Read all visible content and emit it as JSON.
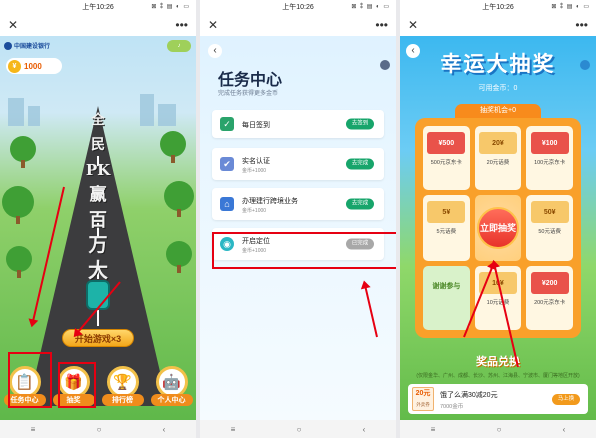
{
  "status_time": "上午10:26",
  "status_icons": "⊠ ⁑ ▤ ◐ ▭",
  "top_close": "✕",
  "top_more": "•••",
  "nav_buttons": [
    "≡",
    "○",
    "‹"
  ],
  "panel1": {
    "bank_name": "中国建设银行",
    "coin_icon": "¥",
    "coins": "1000",
    "slogan_chars": [
      "全",
      "民",
      "PK",
      "赢",
      "百",
      "万",
      "大",
      "礼"
    ],
    "start_button": "开始游戏×3",
    "menu": [
      {
        "label": "任务中心",
        "icon": "📋"
      },
      {
        "label": "抽奖",
        "icon": "🎁"
      },
      {
        "label": "排行榜",
        "icon": "🏆"
      },
      {
        "label": "个人中心",
        "icon": "🤖"
      }
    ]
  },
  "panel2": {
    "back": "‹",
    "title": "任务中心",
    "subtitle": "完成任务获得更多金币",
    "tasks": [
      {
        "name": "每日签到",
        "reward": "",
        "button": "去签到",
        "icon": "✓",
        "color": "#2aa36b",
        "disabled": false
      },
      {
        "name": "实名认证",
        "reward": "金币+1000",
        "button": "去完成",
        "icon": "✔",
        "color": "#6a8ad6",
        "disabled": false
      },
      {
        "name": "办理建行跨境业务",
        "reward": "金币+1000",
        "button": "去完成",
        "icon": "⌂",
        "color": "#3a78d6",
        "disabled": false
      },
      {
        "name": "开启定位",
        "reward": "金币+1000",
        "button": "已完成",
        "icon": "◉",
        "color": "#2bb7c4",
        "disabled": true
      }
    ]
  },
  "panel3": {
    "back": "‹",
    "title": "幸运大抽奖",
    "available": "可用金币：0",
    "chances": "抽奖机会+0",
    "prizes": [
      {
        "label": "500元京东卡",
        "badge": "¥500",
        "color": "#e9524a"
      },
      {
        "label": "20元话费",
        "badge": "20¥",
        "color": "#f7c86a"
      },
      {
        "label": "100元京东卡",
        "badge": "¥100",
        "color": "#e9524a"
      },
      {
        "label": "5元话费",
        "badge": "5¥",
        "color": "#f7c86a"
      },
      {
        "label": "50元话费",
        "badge": "50¥",
        "color": "#f7c86a"
      },
      {
        "label": "10元话费",
        "badge": "10¥",
        "color": "#f7c86a"
      },
      {
        "label": "200元京东卡",
        "badge": "¥200",
        "color": "#e9524a"
      }
    ],
    "center_button": "立即抽奖",
    "thanks": "谢谢参与",
    "exchange_title": "奖品兑换",
    "exchange_sub": "(仅限金华、广州、成都、长沙、苏州、江海县、宁波市、厦门等地区开放)",
    "exchange_item": {
      "badge": "20元",
      "badge_sub": "外卖券",
      "title": "饿了么满30减20元",
      "cost": "7000金币",
      "button": "马上换"
    }
  }
}
